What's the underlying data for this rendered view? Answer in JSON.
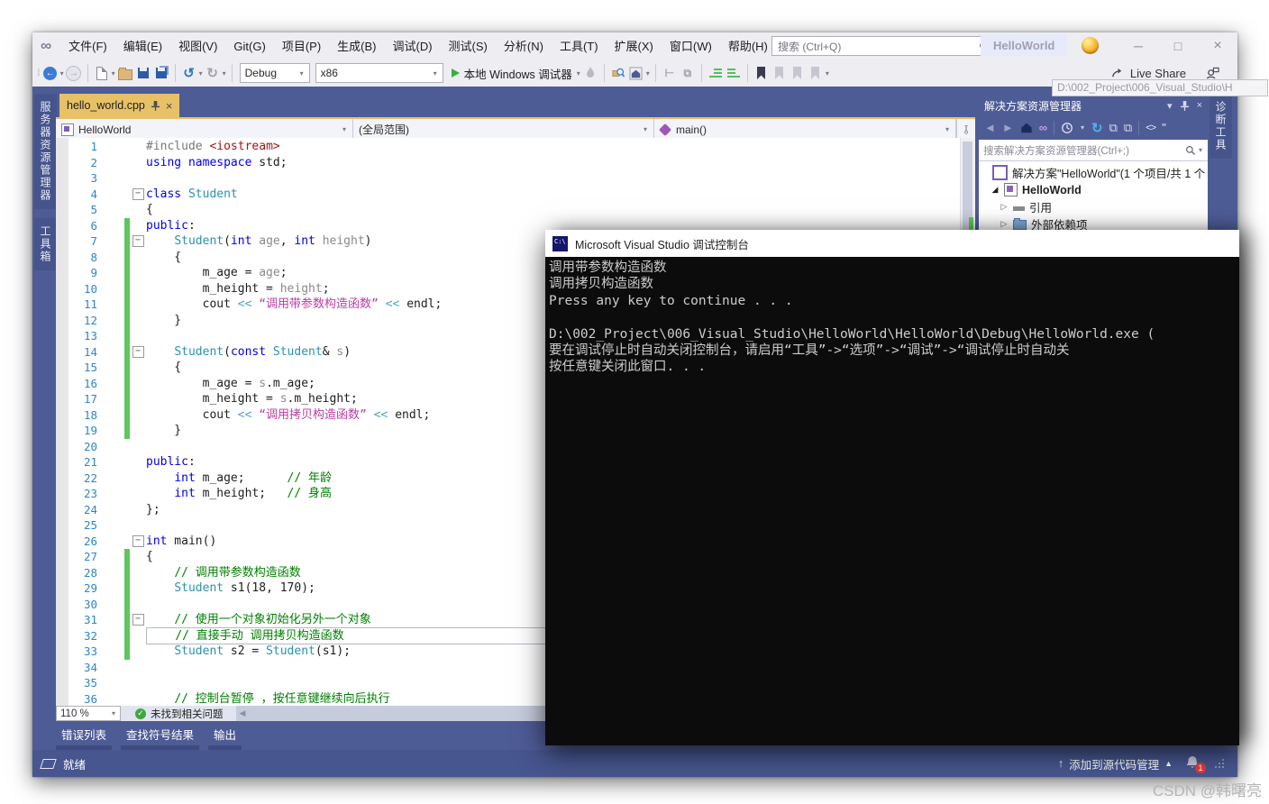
{
  "window": {
    "menus": [
      "文件(F)",
      "编辑(E)",
      "视图(V)",
      "Git(G)",
      "项目(P)",
      "生成(B)",
      "调试(D)",
      "测试(S)",
      "分析(N)",
      "工具(T)",
      "扩展(X)",
      "窗口(W)",
      "帮助(H)"
    ],
    "search_placeholder": "搜索 (Ctrl+Q)",
    "account_label": "HelloWorld",
    "minimize": "─",
    "maximize": "□",
    "close": "×"
  },
  "toolbar": {
    "debug_config": "Debug",
    "platform": "x86",
    "start_label": "本地 Windows 调试器",
    "live_share": "Live Share"
  },
  "left_tabs": [
    "服务器资源管理器",
    "工具箱"
  ],
  "right_tabs": [
    "诊断工具"
  ],
  "tooltip_path": "D:\\002_Project\\006_Visual_Studio\\H",
  "editor": {
    "tab_label": "hello_world.cpp",
    "nav_project": "HelloWorld",
    "nav_scope": "(全局范围)",
    "nav_member": "main()",
    "zoom_level": "110 %",
    "health_text": "未找到相关问题",
    "lines": [
      {
        "n": 1,
        "tokens": [
          [
            "pre",
            "#include "
          ],
          [
            "inc",
            "<iostream>"
          ]
        ]
      },
      {
        "n": 2,
        "tokens": [
          [
            "kw",
            "using"
          ],
          [
            "pln",
            " "
          ],
          [
            "kw",
            "namespace"
          ],
          [
            "pln",
            " std;"
          ]
        ]
      },
      {
        "n": 3,
        "tokens": []
      },
      {
        "n": 4,
        "fold": true,
        "tokens": [
          [
            "kw",
            "class"
          ],
          [
            "pln",
            " "
          ],
          [
            "typ",
            "Student"
          ]
        ]
      },
      {
        "n": 5,
        "tokens": [
          [
            "pln",
            "{"
          ]
        ]
      },
      {
        "n": 6,
        "change": true,
        "tokens": [
          [
            "kw",
            "public"
          ],
          [
            "pln",
            ":"
          ]
        ]
      },
      {
        "n": 7,
        "change": true,
        "fold": true,
        "tokens": [
          [
            "pln",
            "    "
          ],
          [
            "typ",
            "Student"
          ],
          [
            "pln",
            "("
          ],
          [
            "kw",
            "int"
          ],
          [
            "pln",
            " "
          ],
          [
            "par",
            "age"
          ],
          [
            "pln",
            ", "
          ],
          [
            "kw",
            "int"
          ],
          [
            "pln",
            " "
          ],
          [
            "par",
            "height"
          ],
          [
            "pln",
            ")"
          ]
        ]
      },
      {
        "n": 8,
        "change": true,
        "tokens": [
          [
            "pln",
            "    {"
          ]
        ]
      },
      {
        "n": 9,
        "change": true,
        "tokens": [
          [
            "pln",
            "        m_age = "
          ],
          [
            "par",
            "age"
          ],
          [
            "pln",
            ";"
          ]
        ]
      },
      {
        "n": 10,
        "change": true,
        "tokens": [
          [
            "pln",
            "        m_height = "
          ],
          [
            "par",
            "height"
          ],
          [
            "pln",
            ";"
          ]
        ]
      },
      {
        "n": 11,
        "change": true,
        "tokens": [
          [
            "pln",
            "        cout "
          ],
          [
            "op",
            "<<"
          ],
          [
            "pln",
            " "
          ],
          [
            "str",
            "“调用带参数构造函数”"
          ],
          [
            "pln",
            " "
          ],
          [
            "op",
            "<<"
          ],
          [
            "pln",
            " endl;"
          ]
        ]
      },
      {
        "n": 12,
        "change": true,
        "tokens": [
          [
            "pln",
            "    }"
          ]
        ]
      },
      {
        "n": 13,
        "change": true,
        "tokens": []
      },
      {
        "n": 14,
        "change": true,
        "fold": true,
        "tokens": [
          [
            "pln",
            "    "
          ],
          [
            "typ",
            "Student"
          ],
          [
            "pln",
            "("
          ],
          [
            "kw",
            "const"
          ],
          [
            "pln",
            " "
          ],
          [
            "typ",
            "Student"
          ],
          [
            "pln",
            "& "
          ],
          [
            "par",
            "s"
          ],
          [
            "pln",
            ")"
          ]
        ]
      },
      {
        "n": 15,
        "change": true,
        "tokens": [
          [
            "pln",
            "    {"
          ]
        ]
      },
      {
        "n": 16,
        "change": true,
        "tokens": [
          [
            "pln",
            "        m_age = "
          ],
          [
            "par",
            "s"
          ],
          [
            "pln",
            ".m_age;"
          ]
        ]
      },
      {
        "n": 17,
        "change": true,
        "tokens": [
          [
            "pln",
            "        m_height = "
          ],
          [
            "par",
            "s"
          ],
          [
            "pln",
            ".m_height;"
          ]
        ]
      },
      {
        "n": 18,
        "change": true,
        "tokens": [
          [
            "pln",
            "        cout "
          ],
          [
            "op",
            "<<"
          ],
          [
            "pln",
            " "
          ],
          [
            "str",
            "“调用拷贝构造函数”"
          ],
          [
            "pln",
            " "
          ],
          [
            "op",
            "<<"
          ],
          [
            "pln",
            " endl;"
          ]
        ]
      },
      {
        "n": 19,
        "change": true,
        "tokens": [
          [
            "pln",
            "    }"
          ]
        ]
      },
      {
        "n": 20,
        "tokens": []
      },
      {
        "n": 21,
        "tokens": [
          [
            "kw",
            "public"
          ],
          [
            "pln",
            ":"
          ]
        ]
      },
      {
        "n": 22,
        "tokens": [
          [
            "pln",
            "    "
          ],
          [
            "kw",
            "int"
          ],
          [
            "pln",
            " m_age;      "
          ],
          [
            "com",
            "// 年龄"
          ]
        ]
      },
      {
        "n": 23,
        "tokens": [
          [
            "pln",
            "    "
          ],
          [
            "kw",
            "int"
          ],
          [
            "pln",
            " m_height;   "
          ],
          [
            "com",
            "// 身高"
          ]
        ]
      },
      {
        "n": 24,
        "tokens": [
          [
            "pln",
            "};"
          ]
        ]
      },
      {
        "n": 25,
        "tokens": []
      },
      {
        "n": 26,
        "fold": true,
        "tokens": [
          [
            "kw",
            "int"
          ],
          [
            "pln",
            " main()"
          ]
        ]
      },
      {
        "n": 27,
        "change": true,
        "tokens": [
          [
            "pln",
            "{"
          ]
        ]
      },
      {
        "n": 28,
        "change": true,
        "tokens": [
          [
            "pln",
            "    "
          ],
          [
            "com",
            "// 调用带参数构造函数"
          ]
        ]
      },
      {
        "n": 29,
        "change": true,
        "tokens": [
          [
            "pln",
            "    "
          ],
          [
            "typ",
            "Student"
          ],
          [
            "pln",
            " s1(18, 170);"
          ]
        ]
      },
      {
        "n": 30,
        "change": true,
        "tokens": []
      },
      {
        "n": 31,
        "change": true,
        "fold": true,
        "tokens": [
          [
            "pln",
            "    "
          ],
          [
            "com",
            "// 使用一个对象初始化另外一个对象"
          ]
        ]
      },
      {
        "n": 32,
        "change": true,
        "current": true,
        "tokens": [
          [
            "pln",
            "    "
          ],
          [
            "com",
            "// 直接手动 调用拷贝构造函数"
          ]
        ]
      },
      {
        "n": 33,
        "change": true,
        "tokens": [
          [
            "pln",
            "    "
          ],
          [
            "typ",
            "Student"
          ],
          [
            "pln",
            " s2 = "
          ],
          [
            "typ",
            "Student"
          ],
          [
            "pln",
            "(s1);"
          ]
        ]
      },
      {
        "n": 34,
        "tokens": []
      },
      {
        "n": 35,
        "tokens": []
      },
      {
        "n": 36,
        "tokens": [
          [
            "pln",
            "    "
          ],
          [
            "com",
            "// 控制台暂停 ，按任意键继续向后执行"
          ]
        ]
      }
    ]
  },
  "solution_explorer": {
    "title": "解决方案资源管理器",
    "search_placeholder": "搜索解决方案资源管理器(Ctrl+;)",
    "tree": [
      {
        "arrow": "",
        "icon": "sln",
        "label": "解决方案\"HelloWorld\"(1 个项目/共 1 个",
        "bold": false
      },
      {
        "arrow": "exp",
        "icon": "proj",
        "label": "HelloWorld",
        "bold": true
      },
      {
        "arrow": "col",
        "icon": "ref",
        "label": "引用",
        "bold": false
      },
      {
        "arrow": "col",
        "icon": "fold",
        "label": "外部依赖项",
        "bold": false
      }
    ]
  },
  "console": {
    "title": "Microsoft Visual Studio 调试控制台",
    "lines": [
      "调用带参数构造函数",
      "调用拷贝构造函数",
      "Press any key to continue . . .",
      "",
      "D:\\002_Project\\006_Visual_Studio\\HelloWorld\\HelloWorld\\Debug\\HelloWorld.exe (",
      "要在调试停止时自动关闭控制台，请启用“工具”->“选项”->“调试”->“调试停止时自动关",
      "按任意键关闭此窗口. . ."
    ]
  },
  "bottom_tabs": [
    "错误列表",
    "查找符号结果",
    "输出"
  ],
  "status_bar": {
    "ready": "就绪",
    "source_control": "添加到源代码管理",
    "notification_count": "1"
  },
  "watermark": "CSDN @韩曙亮",
  "colors": {
    "chrome_bg": "#EDEDF2",
    "shell_blue": "#4E5C96",
    "status_blue": "#47568F",
    "active_tab_gold": "#E7C167",
    "change_bar_green": "#5FC65F",
    "keyword": "#0000E6",
    "type": "#2B91AF",
    "string": "#BB3BA3",
    "comment": "#008000",
    "console_bg": "#0C0C0C",
    "console_fg": "#CCCCCC"
  }
}
